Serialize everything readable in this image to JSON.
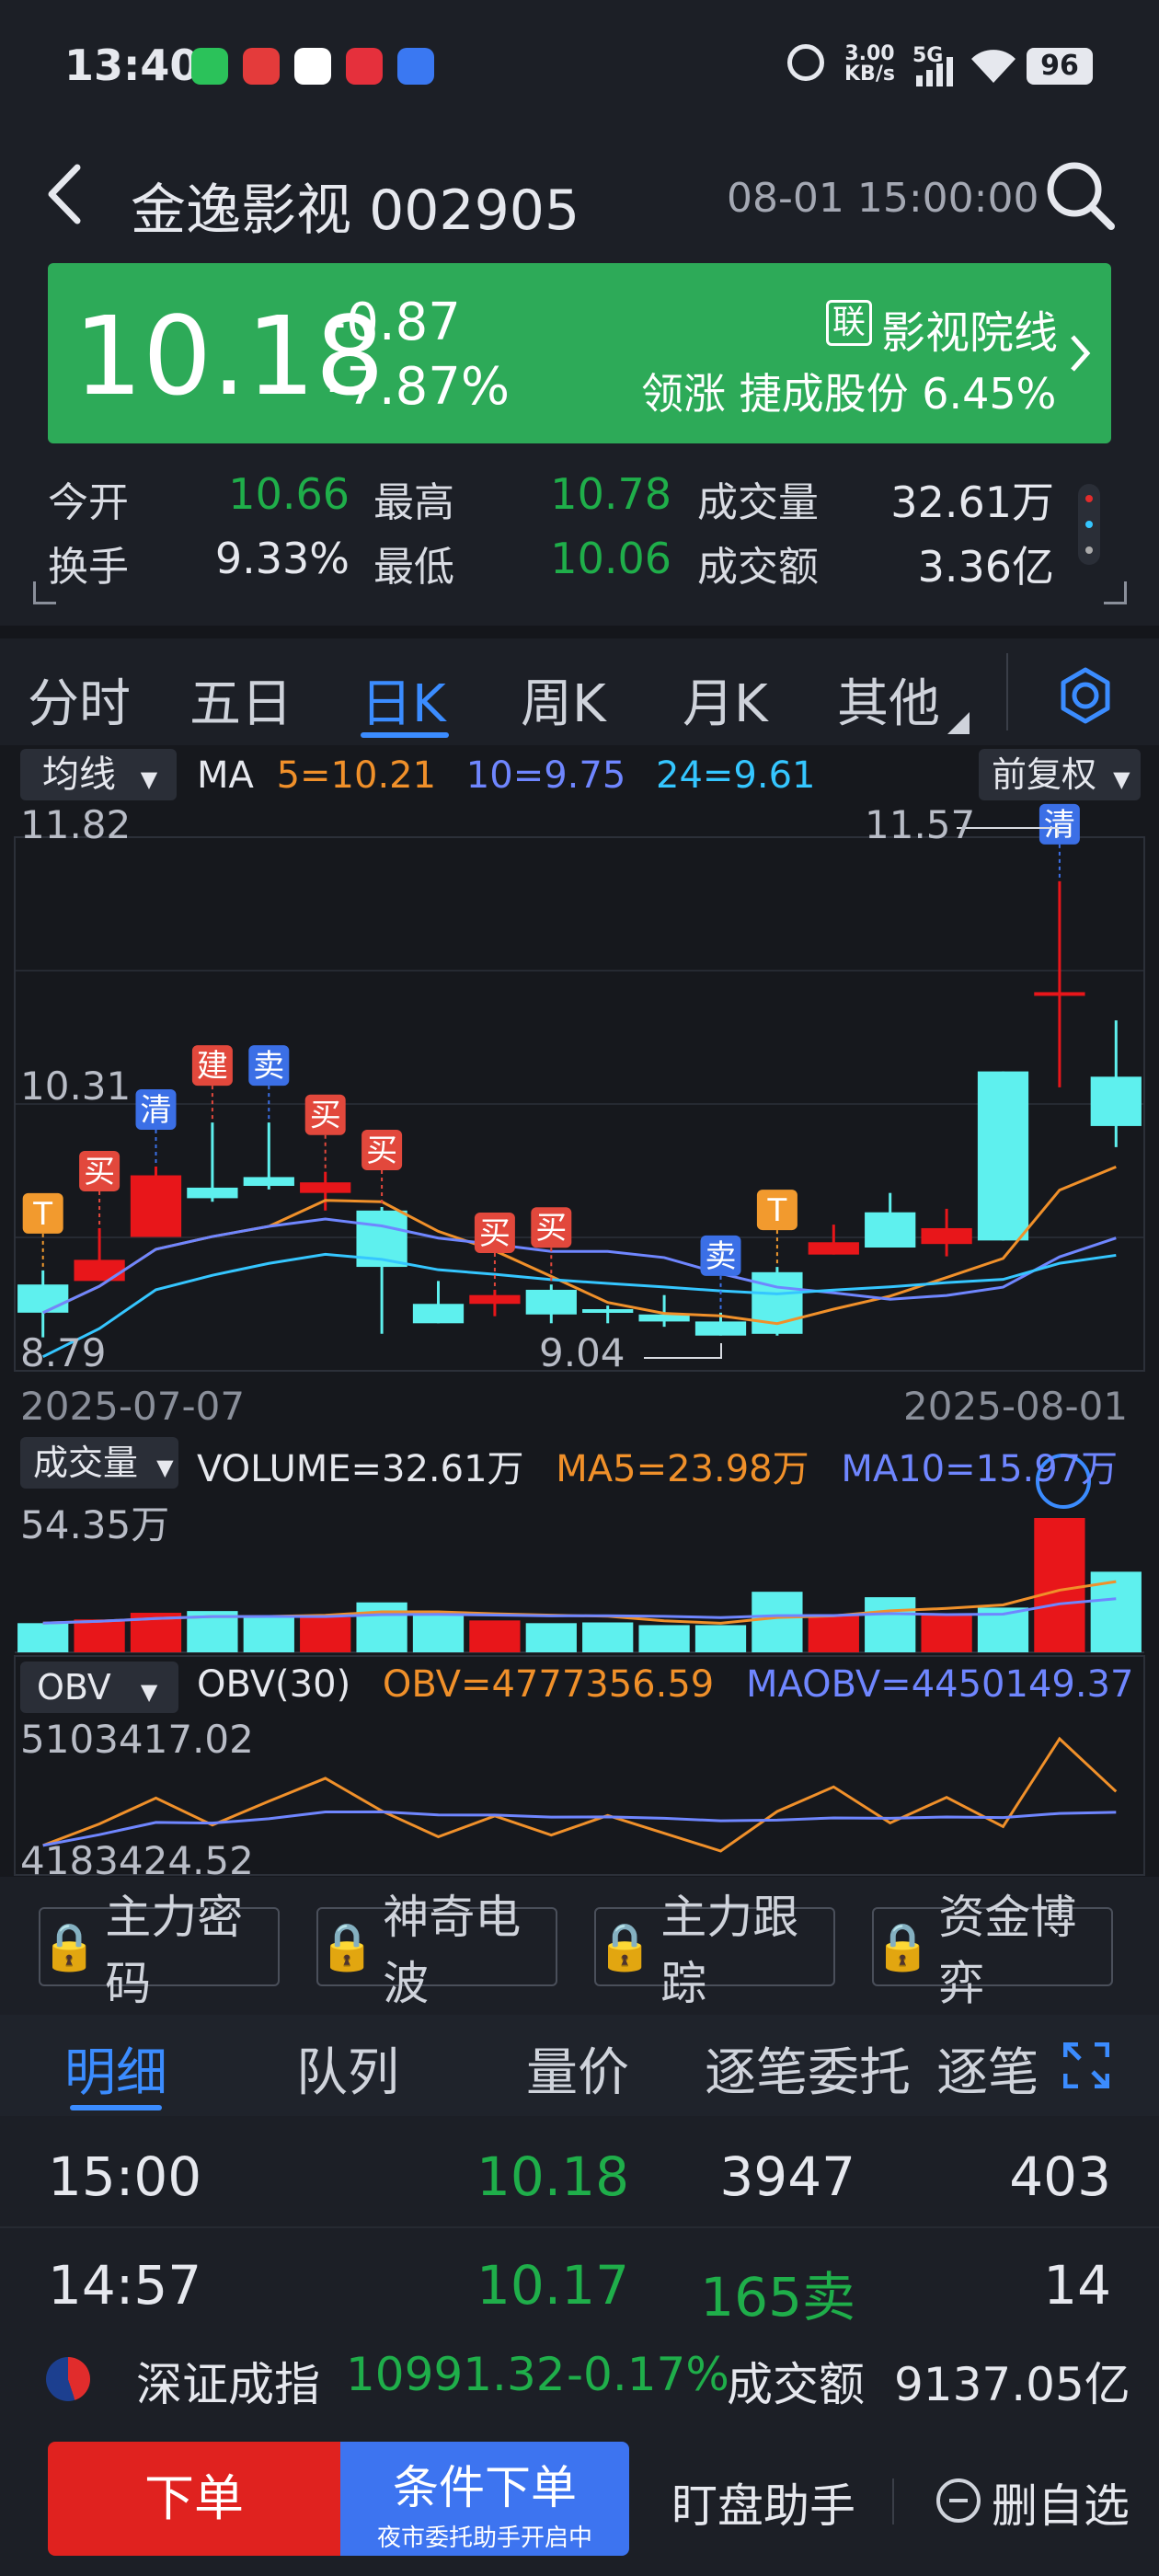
{
  "status": {
    "time": "13:40",
    "net_speed_top": "3.00",
    "net_speed_bottom": "KB/s",
    "signal": "5G",
    "battery": "96",
    "app_icons": [
      "wechat-icon",
      "taobao-icon",
      "app-icon",
      "xiaohongshu-icon",
      "baidu-icon"
    ]
  },
  "header": {
    "title": "金逸影视 002905",
    "datetime": "08-01 15:00:00"
  },
  "quote": {
    "price": "10.18",
    "change": "-0.87",
    "change_pct": "-7.87%",
    "sector_badge": "联",
    "sector": "影视院线",
    "leader_label": "领涨",
    "leader_name": "捷成股份",
    "leader_pct": "6.45%"
  },
  "stats": {
    "open_label": "今开",
    "open": "10.66",
    "high_label": "最高",
    "high": "10.78",
    "vol_label": "成交量",
    "vol": "32.61万",
    "turnover_label": "换手",
    "turnover": "9.33%",
    "low_label": "最低",
    "low": "10.06",
    "amount_label": "成交额",
    "amount": "3.36亿"
  },
  "tabs": [
    "分时",
    "五日",
    "日K",
    "周K",
    "月K",
    "其他"
  ],
  "active_tab": "日K",
  "chart": {
    "ma_selector": "均线",
    "ma_label": "MA",
    "ma5": "5=10.21",
    "ma10": "10=9.75",
    "ma24": "24=9.61",
    "adjust": "前复权",
    "top_price": "11.82",
    "mid_price": "10.31",
    "bottom_price": "8.79",
    "high_note": "11.57",
    "low_note": "9.04",
    "date_start": "2025-07-07",
    "date_end": "2025-08-01",
    "vol_selector": "成交量",
    "volume_text": "VOLUME=32.61万",
    "vol_ma5": "MA5=23.98万",
    "vol_ma10": "MA10=15.97万",
    "vol_max": "54.35万",
    "obv_selector": "OBV",
    "obv_label": "OBV(30)",
    "obv_val": "OBV=4777356.59",
    "maobv_val": "MAOBV=4450149.37",
    "obv_top": "5103417.02",
    "obv_bottom": "4183424.52"
  },
  "chart_data": {
    "type": "candlestick",
    "price_range": [
      8.79,
      11.82
    ],
    "candles": [
      {
        "o": 9.28,
        "c": 9.12,
        "h": 9.36,
        "l": 8.98
      },
      {
        "o": 9.3,
        "c": 9.42,
        "h": 9.6,
        "l": 9.3
      },
      {
        "o": 9.55,
        "c": 9.9,
        "h": 9.95,
        "l": 9.55
      },
      {
        "o": 9.83,
        "c": 9.77,
        "h": 10.2,
        "l": 9.75
      },
      {
        "o": 9.89,
        "c": 9.84,
        "h": 10.2,
        "l": 9.82
      },
      {
        "o": 9.8,
        "c": 9.86,
        "h": 9.92,
        "l": 9.7
      },
      {
        "o": 9.7,
        "c": 9.38,
        "h": 9.72,
        "l": 9.0
      },
      {
        "o": 9.17,
        "c": 9.06,
        "h": 9.3,
        "l": 9.06
      },
      {
        "o": 9.17,
        "c": 9.22,
        "h": 9.25,
        "l": 9.1
      },
      {
        "o": 9.25,
        "c": 9.11,
        "h": 9.28,
        "l": 9.06
      },
      {
        "o": 9.14,
        "c": 9.12,
        "h": 9.16,
        "l": 9.06
      },
      {
        "o": 9.11,
        "c": 9.07,
        "h": 9.22,
        "l": 9.04
      },
      {
        "o": 9.07,
        "c": 8.99,
        "h": 9.12,
        "l": 8.99
      },
      {
        "o": 9.35,
        "c": 9.0,
        "h": 9.38,
        "l": 8.99
      },
      {
        "o": 9.45,
        "c": 9.52,
        "h": 9.62,
        "l": 9.45
      },
      {
        "o": 9.69,
        "c": 9.49,
        "h": 9.8,
        "l": 9.49
      },
      {
        "o": 9.51,
        "c": 9.6,
        "h": 9.71,
        "l": 9.44
      },
      {
        "o": 10.49,
        "c": 9.53,
        "h": 10.49,
        "l": 9.53
      },
      {
        "o": 10.94,
        "c": 10.94,
        "h": 11.57,
        "l": 10.4
      },
      {
        "o": 10.46,
        "c": 10.18,
        "h": 10.78,
        "l": 10.06
      }
    ],
    "volumes": [
      11.8,
      13.3,
      16.0,
      16.7,
      14.7,
      14.2,
      20.2,
      16.0,
      12.9,
      11.8,
      12.1,
      11.0,
      11.0,
      24.5,
      15.2,
      22.3,
      15.8,
      18.1,
      54.35,
      32.61
    ],
    "markers": [
      {
        "i": 0,
        "t": "T"
      },
      {
        "i": 1,
        "t": "买"
      },
      {
        "i": 2,
        "t": "清"
      },
      {
        "i": 3,
        "t": "建"
      },
      {
        "i": 4,
        "t": "卖"
      },
      {
        "i": 5,
        "t": "买"
      },
      {
        "i": 6,
        "t": "买"
      },
      {
        "i": 8,
        "t": "买"
      },
      {
        "i": 9,
        "t": "买"
      },
      {
        "i": 12,
        "t": "卖"
      },
      {
        "i": 13,
        "t": "T"
      },
      {
        "i": 18,
        "t": "清"
      }
    ]
  },
  "lock_buttons": [
    "主力密码",
    "神奇电波",
    "主力跟踪",
    "资金博弈"
  ],
  "detail_tabs": [
    "明细",
    "队列",
    "量价",
    "逐笔委托",
    "逐笔"
  ],
  "trades": [
    {
      "time": "15:00",
      "price": "10.18",
      "vol": "3947",
      "count": "403"
    },
    {
      "time": "14:57",
      "price": "10.17",
      "vol": "165卖",
      "count": "14"
    }
  ],
  "index": {
    "name": "深证成指",
    "value": "10991.32",
    "change": "-0.17%",
    "amount_label": "成交额",
    "amount": "9137.05亿"
  },
  "bottom": {
    "order": "下单",
    "cond_order": "条件下单",
    "cond_sub": "夜市委托助手开启中",
    "assistant": "盯盘助手",
    "remove": "删自选"
  }
}
